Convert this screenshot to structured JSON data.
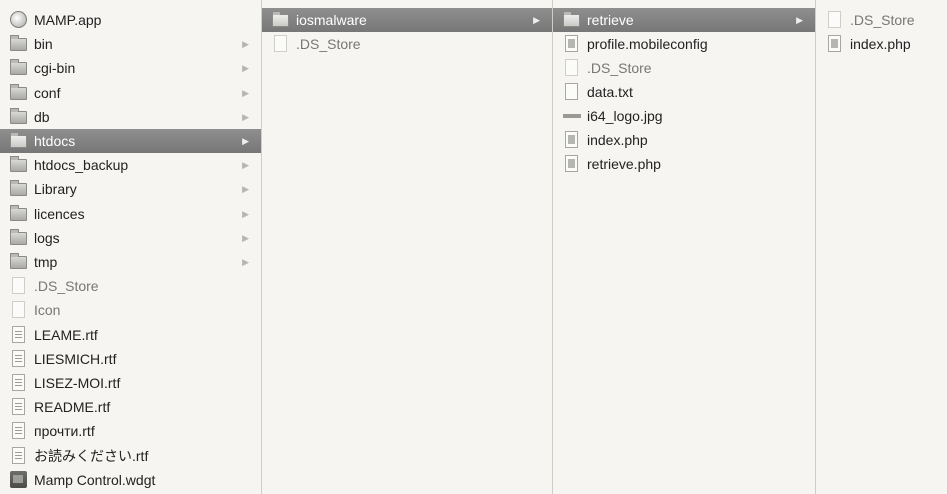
{
  "columns": [
    {
      "items": [
        {
          "label": "MAMP.app",
          "icon": "app-icon"
        },
        {
          "label": "bin",
          "icon": "folder-icon",
          "chevron": true
        },
        {
          "label": "cgi-bin",
          "icon": "folder-icon",
          "chevron": true
        },
        {
          "label": "conf",
          "icon": "folder-icon",
          "chevron": true
        },
        {
          "label": "db",
          "icon": "folder-icon",
          "chevron": true
        },
        {
          "label": "htdocs",
          "icon": "folder-icon",
          "chevron": true,
          "selected": true
        },
        {
          "label": "htdocs_backup",
          "icon": "folder-icon",
          "chevron": true
        },
        {
          "label": "Library",
          "icon": "folder-icon",
          "chevron": true
        },
        {
          "label": "licences",
          "icon": "folder-icon",
          "chevron": true
        },
        {
          "label": "logs",
          "icon": "folder-icon",
          "chevron": true
        },
        {
          "label": "tmp",
          "icon": "folder-icon",
          "chevron": true
        },
        {
          "label": ".DS_Store",
          "icon": "file-icon",
          "muted": true
        },
        {
          "label": "Icon",
          "icon": "file-icon",
          "muted": true
        },
        {
          "label": "LEAME.rtf",
          "icon": "rtf-document-icon"
        },
        {
          "label": "LIESMICH.rtf",
          "icon": "rtf-document-icon"
        },
        {
          "label": "LISEZ-MOI.rtf",
          "icon": "rtf-document-icon"
        },
        {
          "label": "README.rtf",
          "icon": "rtf-document-icon"
        },
        {
          "label": "прочти.rtf",
          "icon": "rtf-document-icon"
        },
        {
          "label": "お読みください.rtf",
          "icon": "rtf-document-icon"
        },
        {
          "label": "Mamp Control.wdgt",
          "icon": "widget-icon"
        }
      ]
    },
    {
      "items": [
        {
          "label": "iosmalware",
          "icon": "folder-icon",
          "chevron": true,
          "selected": true
        },
        {
          "label": ".DS_Store",
          "icon": "file-icon",
          "muted": true
        }
      ]
    },
    {
      "items": [
        {
          "label": "retrieve",
          "icon": "folder-icon",
          "chevron": true,
          "selected": true
        },
        {
          "label": "profile.mobileconfig",
          "icon": "config-document-icon"
        },
        {
          "label": ".DS_Store",
          "icon": "file-icon",
          "muted": true
        },
        {
          "label": "data.txt",
          "icon": "text-document-icon"
        },
        {
          "label": "i64_logo.jpg",
          "icon": "image-icon"
        },
        {
          "label": "index.php",
          "icon": "php-document-icon"
        },
        {
          "label": "retrieve.php",
          "icon": "php-document-icon"
        }
      ]
    },
    {
      "items": [
        {
          "label": ".DS_Store",
          "icon": "file-icon",
          "muted": true
        },
        {
          "label": "index.php",
          "icon": "php-document-icon"
        }
      ]
    }
  ]
}
